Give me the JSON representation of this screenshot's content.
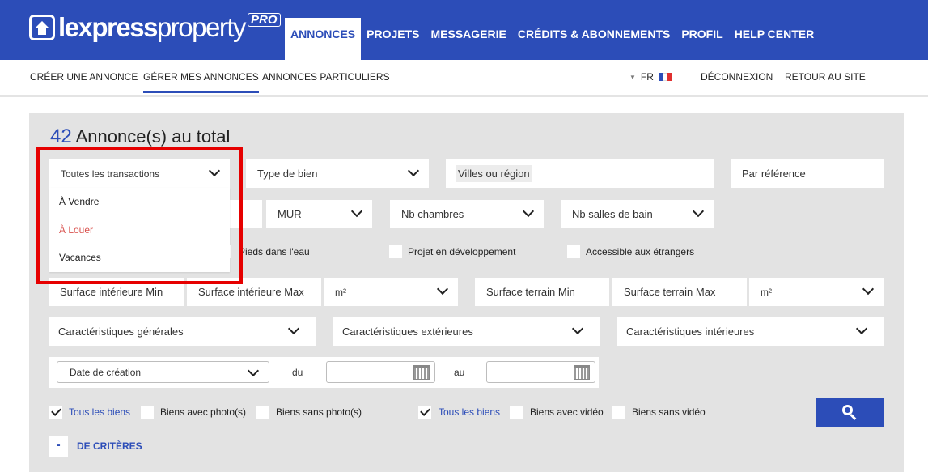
{
  "brand": {
    "logo_bold": "lexpress",
    "logo_light": "property",
    "logo_pro": "PRO"
  },
  "main_nav": [
    {
      "label": "ANNONCES",
      "active": true
    },
    {
      "label": "PROJETS"
    },
    {
      "label": "MESSAGERIE"
    },
    {
      "label": "CRÉDITS & ABONNEMENTS"
    },
    {
      "label": "PROFIL"
    },
    {
      "label": "HELP CENTER"
    }
  ],
  "sub_nav": {
    "items": [
      {
        "label": "CRÉER UNE ANNONCE"
      },
      {
        "label": "GÉRER MES ANNONCES",
        "active": true
      },
      {
        "label": "ANNONCES PARTICULIERS"
      }
    ],
    "lang": "FR",
    "logout": "DÉCONNEXION",
    "back": "RETOUR AU SITE"
  },
  "summary": {
    "count": "42",
    "label": "Annonce(s) au total"
  },
  "filters": {
    "transaction": "Toutes les transactions",
    "property_type": "Type de bien",
    "cities_placeholder": "Villes ou région",
    "reference_placeholder": "Par référence",
    "currency": "MUR",
    "bedrooms": "Nb chambres",
    "bathrooms": "Nb salles de bain",
    "pieds_dans_eau": "Pieds dans l'eau",
    "projet_dev": "Projet en développement",
    "accessible_etrangers": "Accessible aux étrangers",
    "surface_int_min": "Surface intérieure Min",
    "surface_int_max": "Surface intérieure Max",
    "unit_m2_a": "m²",
    "surface_terrain_min": "Surface terrain Min",
    "surface_terrain_max": "Surface terrain Max",
    "unit_m2_b": "m²",
    "carac_generales": "Caractéristiques générales",
    "carac_exterieures": "Caractéristiques extérieures",
    "carac_interieures": "Caractéristiques intérieures",
    "date_type": "Date de création",
    "du": "du",
    "au": "au",
    "photo_all": "Tous les biens",
    "photo_with": "Biens avec photo(s)",
    "photo_without": "Biens sans photo(s)",
    "video_all": "Tous les biens",
    "video_with": "Biens avec vidéo",
    "video_without": "Biens sans vidéo",
    "criteria_toggle": "-",
    "criteria_label": "DE CRITÈRES"
  },
  "transaction_dropdown": {
    "options": [
      "À Vendre",
      "À Louer",
      "Vacances"
    ],
    "hovered_index": 1,
    "hover_color": "#d9534f"
  },
  "colors": {
    "brand_blue": "#2c4db8",
    "panel_gray": "#e3e3e3",
    "highlight_red": "#e60000"
  },
  "icons": {
    "search": "magnifier-icon",
    "calendar": "calendar-icon",
    "chevron": "chevron-down-icon"
  }
}
